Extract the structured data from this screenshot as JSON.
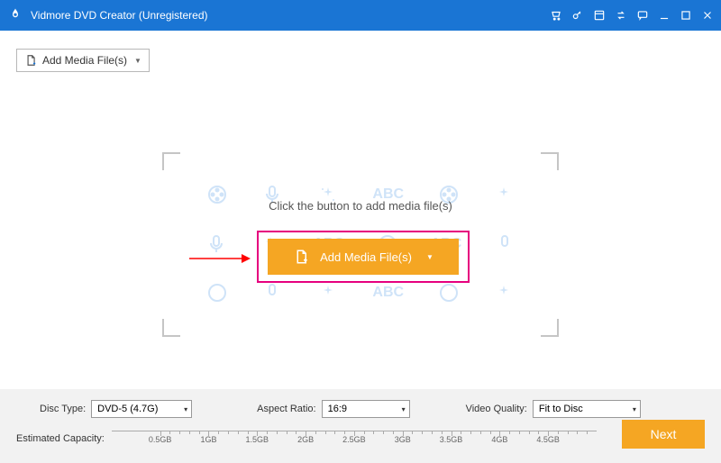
{
  "titlebar": {
    "title": "Vidmore DVD Creator (Unregistered)"
  },
  "toolbar": {
    "add_media_label": "Add Media File(s)"
  },
  "dropzone": {
    "prompt": "Click the button to add media file(s)",
    "main_button_label": "Add Media File(s)",
    "bg_text": "ABC"
  },
  "bottom": {
    "disc_type_label": "Disc Type:",
    "disc_type_value": "DVD-5 (4.7G)",
    "aspect_label": "Aspect Ratio:",
    "aspect_value": "16:9",
    "quality_label": "Video Quality:",
    "quality_value": "Fit to Disc",
    "capacity_label": "Estimated Capacity:",
    "ticks": [
      "0.5GB",
      "1GB",
      "1.5GB",
      "2GB",
      "2.5GB",
      "3GB",
      "3.5GB",
      "4GB",
      "4.5GB"
    ],
    "next_label": "Next"
  }
}
